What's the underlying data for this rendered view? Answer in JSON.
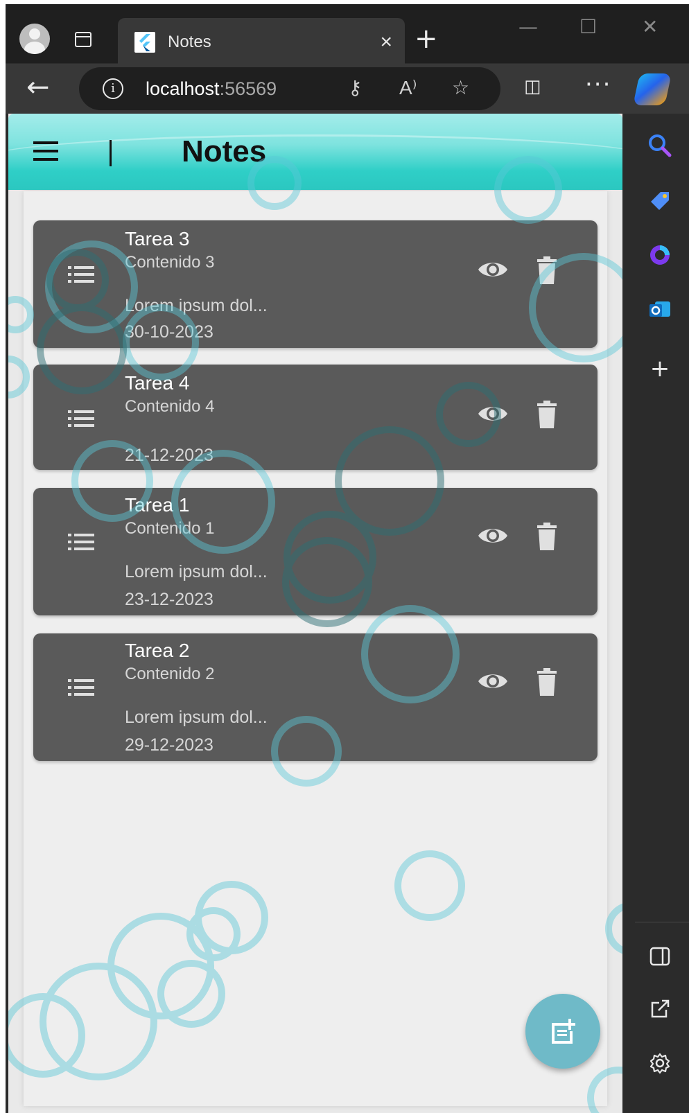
{
  "browser": {
    "tab_title": "Notes",
    "tab_close": "×",
    "new_tab": "+",
    "url_host": "localhost",
    "url_port": ":56569",
    "more": "···",
    "minimize": "—",
    "maximize": "☐",
    "close": "✕",
    "back": "←",
    "add": "+"
  },
  "app": {
    "title": "Notes",
    "accent": "#2fcfc7",
    "card_color": "#5a5a5a",
    "notes": [
      {
        "title": "Tarea 3",
        "content": "Contenido 3",
        "body": "Lorem ipsum dol...",
        "date": "30-10-2023"
      },
      {
        "title": "Tarea 4",
        "content": "Contenido 4",
        "body": "",
        "date": "21-12-2023"
      },
      {
        "title": "Tarea 1",
        "content": "Contenido 1",
        "body": "Lorem ipsum dol...",
        "date": "23-12-2023"
      },
      {
        "title": "Tarea 2",
        "content": "Contenido 2",
        "body": "Lorem ipsum dol...",
        "date": "29-12-2023"
      }
    ]
  }
}
